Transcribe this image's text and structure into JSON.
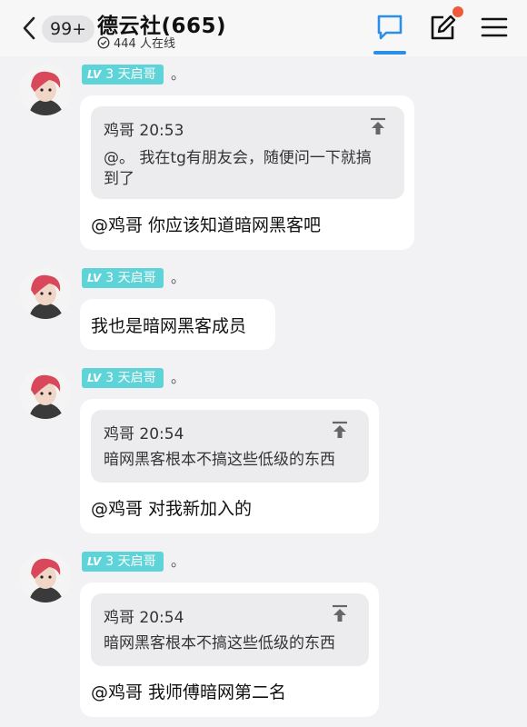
{
  "header": {
    "back_icon": "chevron-left-icon",
    "unread_badge": "99+",
    "title": "德云社(665)",
    "online_icon": "check-circle-icon",
    "online_text": "444 人在线",
    "chat_icon": "chat-bubble-icon",
    "compose_icon": "edit-icon",
    "menu_icon": "hamburger-menu-icon",
    "accent_color": "#2b8fe8",
    "notification_dot_color": "#f05a3c"
  },
  "messages": [
    {
      "level": "LV",
      "level_num": "3",
      "title": "天启哥",
      "nickname": "。",
      "quote": {
        "author_time": "鸡哥 20:53",
        "text_line1": "@。 我在tg有朋友会，随便问一下就搞",
        "text_line2": "到了"
      },
      "reply": "@鸡哥 你应该知道暗网黑客吧"
    },
    {
      "level": "LV",
      "level_num": "3",
      "title": "天启哥",
      "nickname": "。",
      "text": "我也是暗网黑客成员"
    },
    {
      "level": "LV",
      "level_num": "3",
      "title": "天启哥",
      "nickname": "。",
      "quote": {
        "author_time": "鸡哥 20:54",
        "text_line1": "暗网黑客根本不搞这些低级的东西"
      },
      "reply": "@鸡哥 对我新加入的"
    },
    {
      "level": "LV",
      "level_num": "3",
      "title": "天启哥",
      "nickname": "。",
      "quote": {
        "author_time": "鸡哥 20:54",
        "text_line1": "暗网黑客根本不搞这些低级的东西"
      },
      "reply": "@鸡哥 我师傅暗网第二名"
    }
  ]
}
